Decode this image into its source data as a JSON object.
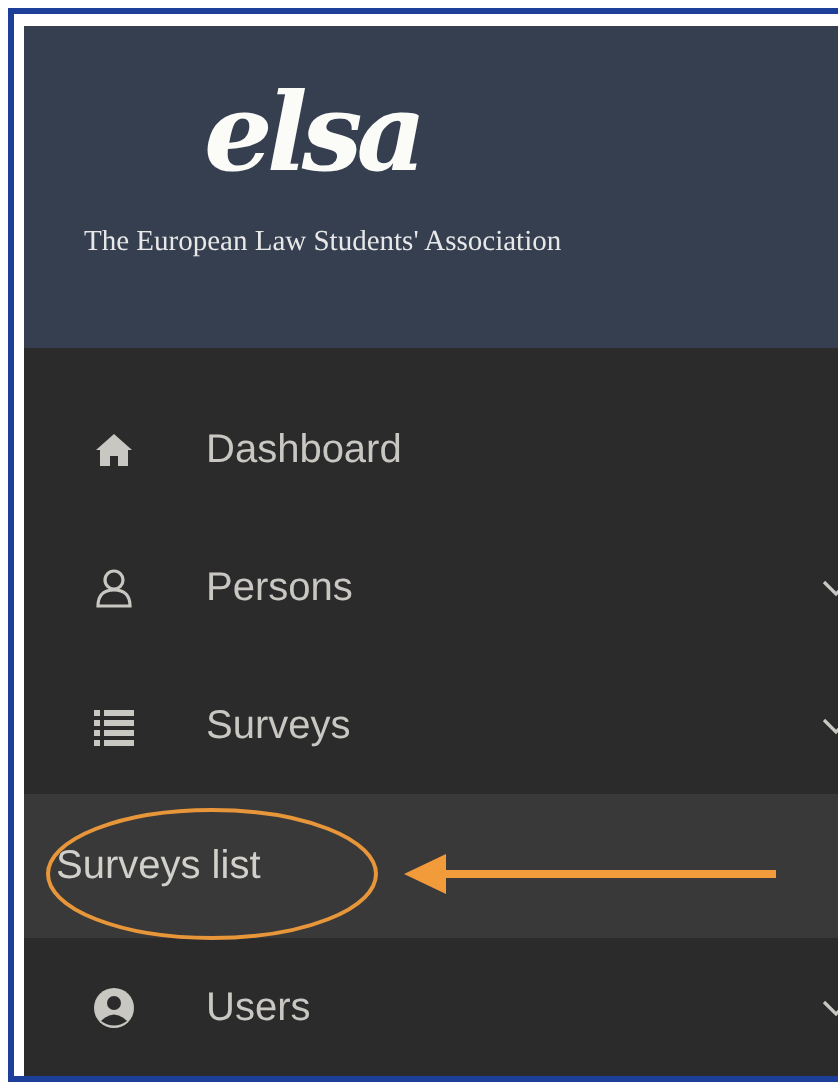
{
  "header": {
    "logo": "elsa",
    "tagline": "The European Law Students' Association"
  },
  "menu": [
    {
      "label": "Dashboard",
      "submenu": false
    },
    {
      "label": "Persons",
      "submenu": true
    },
    {
      "label": "Surveys",
      "submenu": true,
      "children": [
        {
          "label": "Surveys list",
          "selected": true
        }
      ]
    },
    {
      "label": "Users",
      "submenu": true
    }
  ]
}
